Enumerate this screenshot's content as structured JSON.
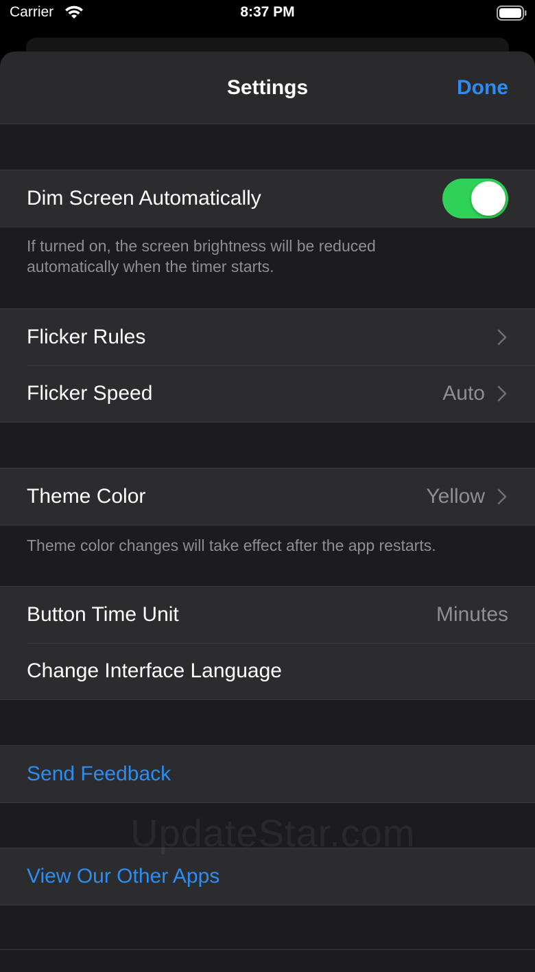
{
  "status_bar": {
    "carrier": "Carrier",
    "time": "8:37 PM",
    "icons": [
      "wifi-icon",
      "battery-icon"
    ]
  },
  "navbar": {
    "title": "Settings",
    "done_label": "Done"
  },
  "sections": {
    "dim": {
      "label": "Dim Screen Automatically",
      "toggle_on": true,
      "footer_line1": "If turned on, the screen brightness will be reduced",
      "footer_line2": "automatically when the timer starts."
    },
    "flicker": {
      "rules_label": "Flicker Rules",
      "speed_label": "Flicker Speed",
      "speed_value": "Auto"
    },
    "theme": {
      "label": "Theme Color",
      "value": "Yellow",
      "footer": "Theme color changes will take effect after the app restarts."
    },
    "general": {
      "time_unit_label": "Button Time Unit",
      "time_unit_value": "Minutes",
      "language_label": "Change Interface Language"
    },
    "feedback": {
      "label": "Send Feedback"
    },
    "other_apps": {
      "label": "View Our Other Apps"
    }
  },
  "watermark": "UpdateStar.com",
  "colors": {
    "accent": "#2d8cf0",
    "toggle_on": "#30d158",
    "background": "#1c1c1e",
    "cell": "#2c2c2e",
    "secondary_text": "#8e8e93"
  }
}
